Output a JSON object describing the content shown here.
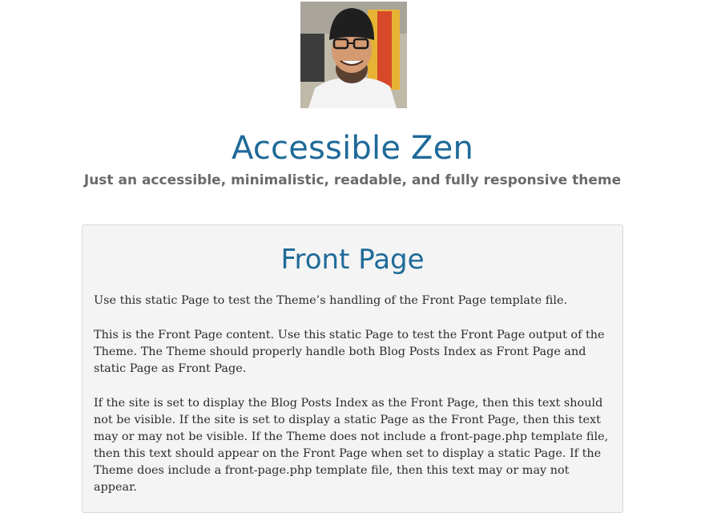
{
  "header": {
    "site_title": "Accessible Zen",
    "site_description": "Just an accessible, minimalistic, readable, and fully responsive theme",
    "avatar_icon": "avatar-photo"
  },
  "entry": {
    "title": "Front Page",
    "paragraphs": [
      "Use this static Page to test the Theme’s handling of the Front Page template file.",
      "This is the Front Page content. Use this static Page to test the Front Page output of the Theme. The Theme should properly handle both Blog Posts Index as Front Page and static Page as Front Page.",
      "If the site is set to display the Blog Posts Index as the Front Page, then this text should not be visible. If the site is set to display a static Page as the Front Page, then this text may or may not be visible. If the Theme does not include a front-page.php template file, then this text should appear on the Front Page when set to display a static Page. If the Theme does include a front-page.php template file, then this text may or may not appear."
    ]
  },
  "colors": {
    "accent": "#1f6a99",
    "description": "#6a6a6a",
    "panel_bg": "#f4f4f4",
    "panel_border": "#d9d9d9",
    "body_text": "#2b2b2b"
  }
}
